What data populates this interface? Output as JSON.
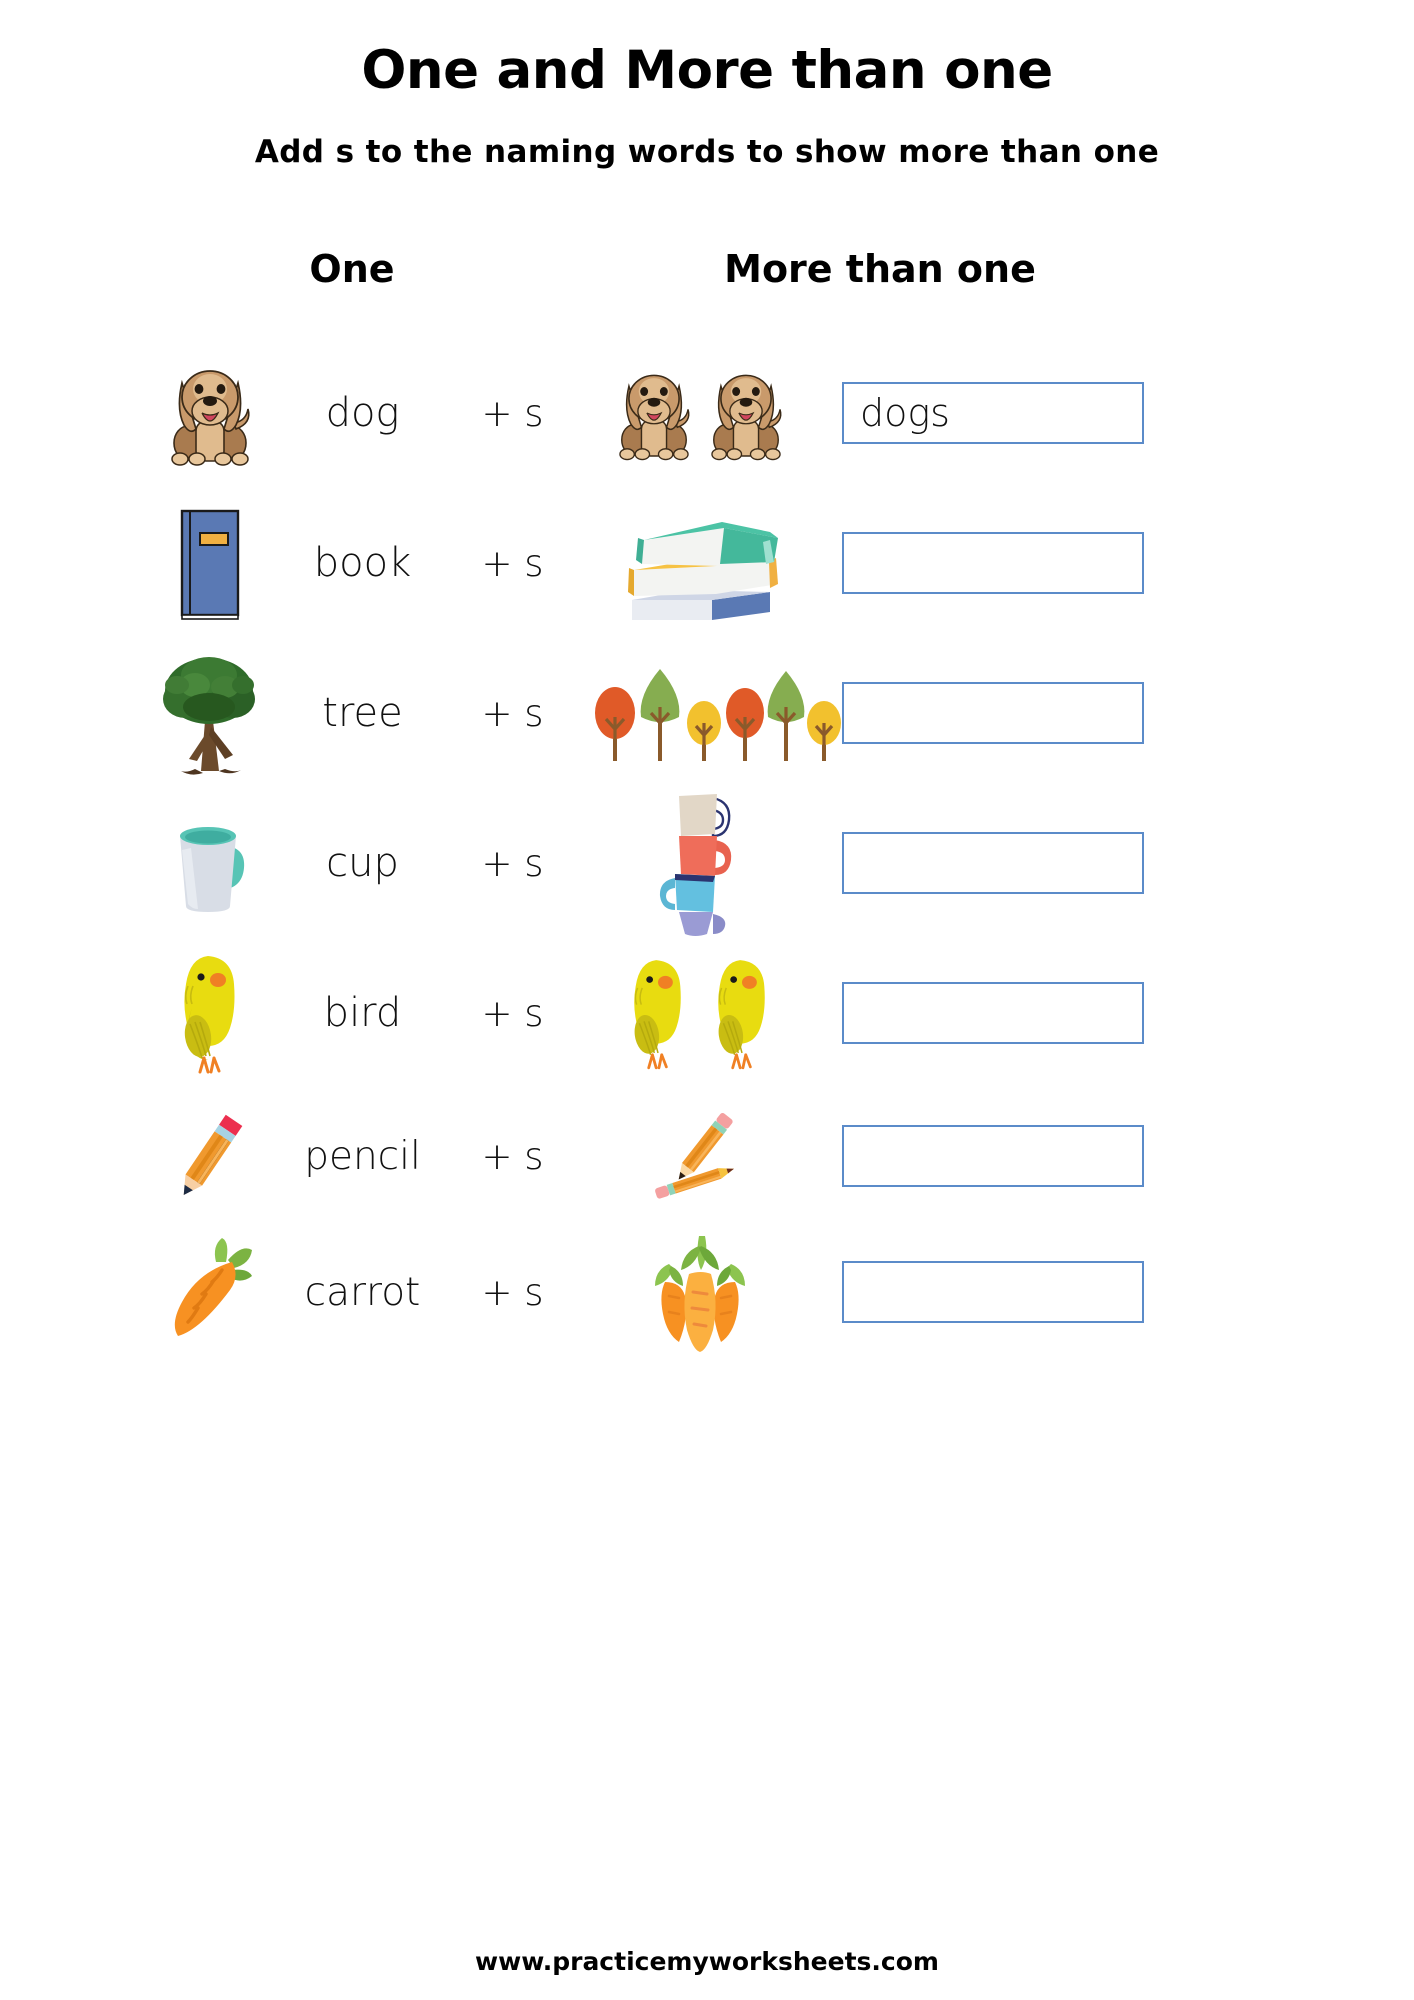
{
  "worksheet": {
    "title": "One and More than one",
    "subtitle": "Add s to the naming words to show more than one",
    "footer_url": "www.practicemyworksheets.com"
  },
  "columns": {
    "singular_heading": "One",
    "plural_heading": "More than one"
  },
  "colors": {
    "answer_box_border": "#5b8bc9",
    "text": "#000000",
    "dog_body": "#c99a6b",
    "dog_light": "#e0bb8e",
    "dog_tongue": "#d1455e",
    "book_blue": "#5a79b4",
    "book_gold": "#f0b042",
    "book_teal": "#4cc3a5",
    "tree_green": "#2f6b2a",
    "tree_trunk": "#6b4a2b",
    "autumn_orange": "#e05a28",
    "autumn_green": "#86ad50",
    "autumn_yellow": "#f2c12e",
    "cup_gray": "#d8dde6",
    "cup_teal": "#57c4b5",
    "cup_beige": "#e2d7c7",
    "cup_coral": "#ef6d5a",
    "cup_blue": "#63c0e0",
    "cup_purple": "#9a9bd4",
    "bird_yellow": "#e8dc10",
    "bird_beak": "#f08024",
    "pencil_orange": "#f0992e",
    "pencil_pink": "#f4a0a0",
    "carrot_orange": "#f79122",
    "carrot_leaf": "#7cb342"
  },
  "rows": [
    {
      "singular": "dog",
      "suffix": "+ s",
      "answer": "dogs",
      "answer_filled": true,
      "icon_one": "dog-icon",
      "icon_many": "two-dogs-icon",
      "plural_count": 2
    },
    {
      "singular": "book",
      "suffix": "+ s",
      "answer": "",
      "answer_filled": false,
      "icon_one": "book-icon",
      "icon_many": "stack-of-books-icon",
      "plural_count": 3
    },
    {
      "singular": "tree",
      "suffix": "+ s",
      "answer": "",
      "answer_filled": false,
      "icon_one": "tree-icon",
      "icon_many": "row-of-trees-icon",
      "plural_count": 6
    },
    {
      "singular": "cup",
      "suffix": "+ s",
      "answer": "",
      "answer_filled": false,
      "icon_one": "cup-icon",
      "icon_many": "stack-of-cups-icon",
      "plural_count": 4
    },
    {
      "singular": "bird",
      "suffix": "+ s",
      "answer": "",
      "answer_filled": false,
      "icon_one": "bird-icon",
      "icon_many": "two-birds-icon",
      "plural_count": 2
    },
    {
      "singular": "pencil",
      "suffix": "+ s",
      "answer": "",
      "answer_filled": false,
      "icon_one": "pencil-icon",
      "icon_many": "two-pencils-icon",
      "plural_count": 2
    },
    {
      "singular": "carrot",
      "suffix": "+ s",
      "answer": "",
      "answer_filled": false,
      "icon_one": "carrot-icon",
      "icon_many": "three-carrots-icon",
      "plural_count": 3
    }
  ]
}
